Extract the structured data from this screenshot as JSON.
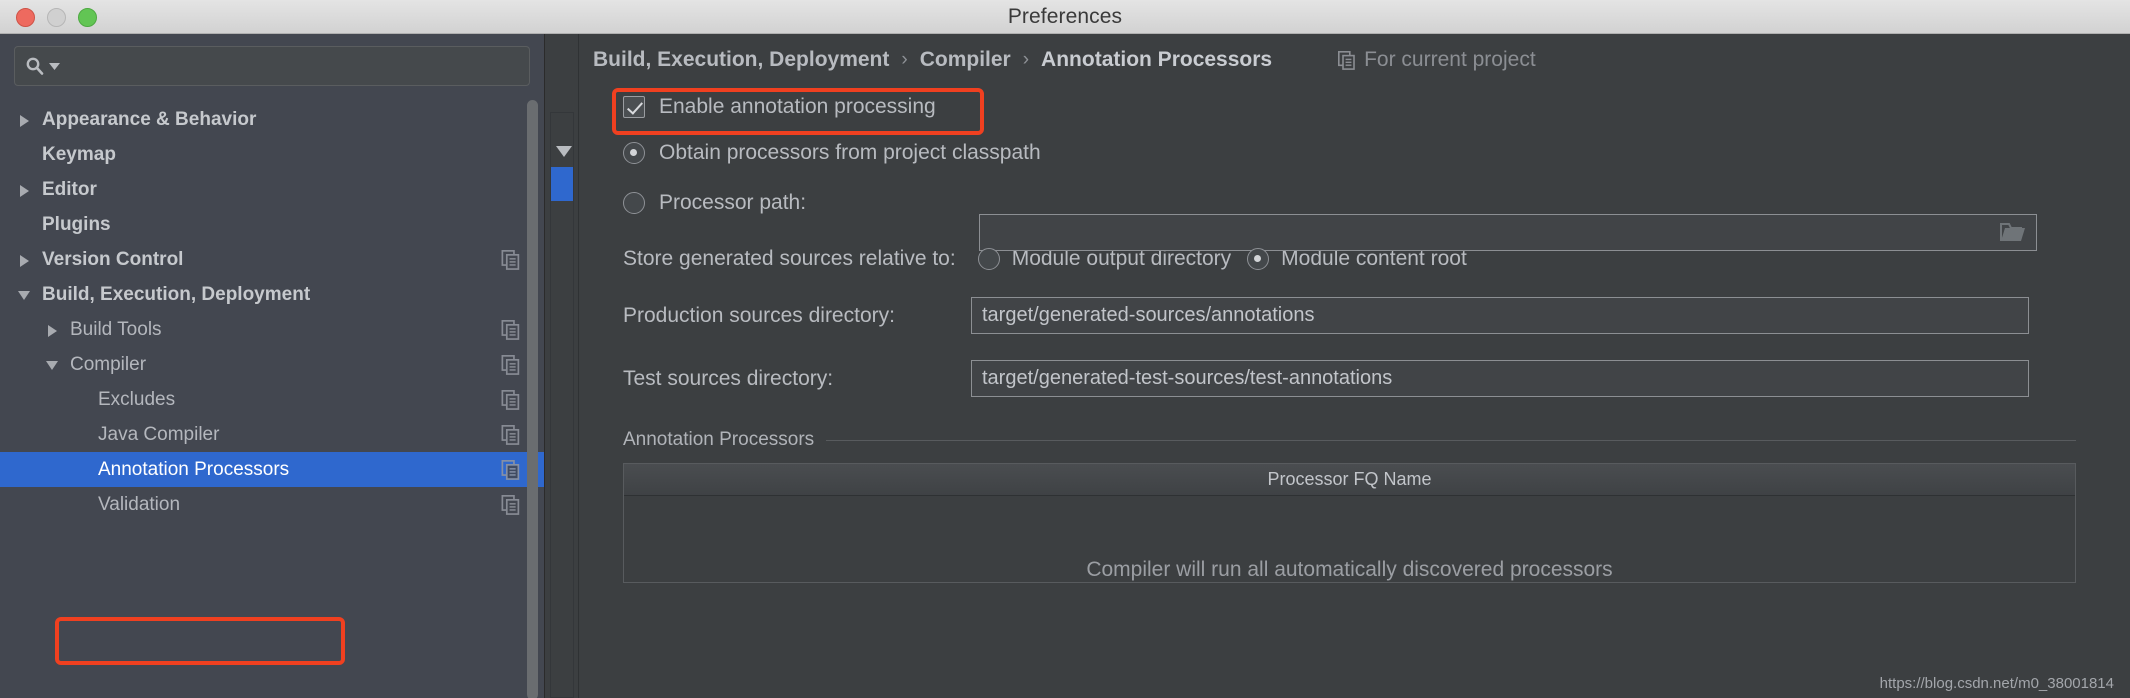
{
  "window": {
    "title": "Preferences",
    "traffic_lights": [
      "close",
      "minimize",
      "maximize"
    ]
  },
  "sidebar": {
    "search": {
      "value": "",
      "placeholder": ""
    },
    "items": [
      {
        "label": "Appearance & Behavior",
        "arrow": "right",
        "indent": 0,
        "bold": true,
        "copy": false,
        "selected": false
      },
      {
        "label": "Keymap",
        "arrow": "none",
        "indent": 0,
        "bold": true,
        "copy": false,
        "selected": false
      },
      {
        "label": "Editor",
        "arrow": "right",
        "indent": 0,
        "bold": true,
        "copy": false,
        "selected": false
      },
      {
        "label": "Plugins",
        "arrow": "none",
        "indent": 0,
        "bold": true,
        "copy": false,
        "selected": false
      },
      {
        "label": "Version Control",
        "arrow": "right",
        "indent": 0,
        "bold": true,
        "copy": true,
        "selected": false
      },
      {
        "label": "Build, Execution, Deployment",
        "arrow": "down",
        "indent": 0,
        "bold": true,
        "copy": false,
        "selected": false
      },
      {
        "label": "Build Tools",
        "arrow": "right",
        "indent": 1,
        "bold": false,
        "copy": true,
        "selected": false
      },
      {
        "label": "Compiler",
        "arrow": "down",
        "indent": 1,
        "bold": false,
        "copy": true,
        "selected": false
      },
      {
        "label": "Excludes",
        "arrow": "none",
        "indent": 2,
        "bold": false,
        "copy": true,
        "selected": false
      },
      {
        "label": "Java Compiler",
        "arrow": "none",
        "indent": 2,
        "bold": false,
        "copy": true,
        "selected": false
      },
      {
        "label": "Annotation Processors",
        "arrow": "none",
        "indent": 2,
        "bold": false,
        "copy": true,
        "selected": true
      },
      {
        "label": "Validation",
        "arrow": "none",
        "indent": 2,
        "bold": false,
        "copy": true,
        "selected": false
      }
    ]
  },
  "breadcrumb": {
    "parts": [
      "Build, Execution, Deployment",
      "Compiler",
      "Annotation Processors"
    ],
    "separator": "›",
    "scope_label": "For current project"
  },
  "settings": {
    "enable_annotation_processing": {
      "label": "Enable annotation processing",
      "checked": true
    },
    "processor_source": {
      "options": [
        {
          "label": "Obtain processors from project classpath",
          "selected": true
        },
        {
          "label": "Processor path:",
          "selected": false
        }
      ],
      "processor_path_value": ""
    },
    "store_generated": {
      "label": "Store generated sources relative to:",
      "options": [
        {
          "label": "Module output directory",
          "selected": false
        },
        {
          "label": "Module content root",
          "selected": true
        }
      ]
    },
    "production_sources": {
      "label": "Production sources directory:",
      "value": "target/generated-sources/annotations"
    },
    "test_sources": {
      "label": "Test sources directory:",
      "value": "target/generated-test-sources/test-annotations"
    }
  },
  "processors_section": {
    "title": "Annotation Processors",
    "column_header": "Processor FQ Name",
    "empty_message": "Compiler will run all automatically discovered processors",
    "rows": []
  },
  "watermark": "https://blog.csdn.net/m0_38001814",
  "colors": {
    "accent_selection": "#2f68ce",
    "annotation_red": "#f04020",
    "panel_bg": "#3c3f41",
    "sidebar_bg": "#434750",
    "text": "#b8bbc0"
  }
}
